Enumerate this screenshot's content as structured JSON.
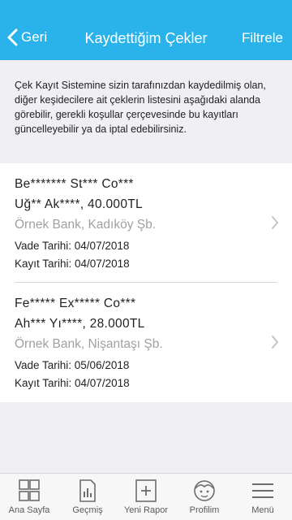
{
  "header": {
    "back_label": "Geri",
    "title": "Kaydettiğim Çekler",
    "filter_label": "Filtrele"
  },
  "info_text": "Çek Kayıt Sistemine sizin tarafınızdan kaydedilmiş olan, diğer keşidecilere ait çeklerin listesini aşağıdaki alanda görebilir, gerekli koşullar çerçevesinde bu kayıtları güncelleyebilir ya da iptal edebilirsiniz.",
  "checks": [
    {
      "company": "Be******* St*** Co***",
      "holder_amount": "Uğ** Ak****, 40.000TL",
      "bank": "Örnek Bank, Kadıköy Şb.",
      "due_date": "Vade Tarihi: 04/07/2018",
      "record_date": "Kayıt Tarihi: 04/07/2018"
    },
    {
      "company": "Fe***** Ex***** Co***",
      "holder_amount": "Ah*** Yı****, 28.000TL",
      "bank": "Örnek Bank, Nişantaşı Şb.",
      "due_date": "Vade Tarihi: 05/06/2018",
      "record_date": "Kayıt Tarihi: 04/07/2018"
    }
  ],
  "tabs": [
    {
      "label": "Ana Sayfa",
      "icon": "home-grid-icon"
    },
    {
      "label": "Geçmiş",
      "icon": "history-chart-icon"
    },
    {
      "label": "Yeni Rapor",
      "icon": "new-report-plus-icon"
    },
    {
      "label": "Profilim",
      "icon": "profile-face-icon"
    },
    {
      "label": "Menü",
      "icon": "hamburger-menu-icon"
    }
  ],
  "colors": {
    "header": "#2ab3ea",
    "background": "#efeff4",
    "muted_text": "#a0a0a0"
  }
}
